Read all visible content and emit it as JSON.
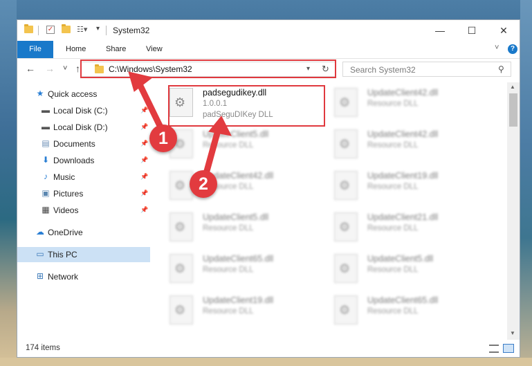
{
  "window": {
    "title": "System32",
    "controls": {
      "minimize": "—",
      "maximize": "☐",
      "close": "✕"
    }
  },
  "ribbon": {
    "tabs": [
      "File",
      "Home",
      "Share",
      "View"
    ],
    "help": "?"
  },
  "navigation": {
    "back": "←",
    "forward": "→",
    "recent": "˅",
    "up": "↑"
  },
  "address": {
    "path": "C:\\Windows\\System32",
    "refresh": "↻"
  },
  "search": {
    "placeholder": "Search System32"
  },
  "nav_pane": {
    "items": [
      {
        "label": "Quick access",
        "icon": "star-icon",
        "pinned": false
      },
      {
        "label": "Local Disk (C:)",
        "icon": "drive-icon",
        "pinned": true
      },
      {
        "label": "Local Disk (D:)",
        "icon": "drive-icon",
        "pinned": true
      },
      {
        "label": "Documents",
        "icon": "documents-icon",
        "pinned": true
      },
      {
        "label": "Downloads",
        "icon": "download-icon",
        "pinned": true
      },
      {
        "label": "Music",
        "icon": "music-icon",
        "pinned": true
      },
      {
        "label": "Pictures",
        "icon": "pictures-icon",
        "pinned": true
      },
      {
        "label": "Videos",
        "icon": "videos-icon",
        "pinned": true
      },
      {
        "label": "OneDrive",
        "icon": "cloud-icon",
        "pinned": false
      },
      {
        "label": "This PC",
        "icon": "computer-icon",
        "pinned": false,
        "selected": true
      },
      {
        "label": "Network",
        "icon": "network-icon",
        "pinned": false
      }
    ]
  },
  "files": [
    {
      "name": "padsegudikey.dll",
      "line2": "1.0.0.1",
      "line3": "padSeguDIKey DLL",
      "highlighted": true
    },
    {
      "name": "UpdateClient42.dll",
      "line2": "Resource DLL"
    },
    {
      "name": "UpdateClient5.dll",
      "line2": "Resource DLL"
    },
    {
      "name": "UpdateClient42.dll",
      "line2": "Resource DLL"
    },
    {
      "name": "UpdateClient42.dll",
      "line2": "Resource DLL"
    },
    {
      "name": "UpdateClient19.dll",
      "line2": "Resource DLL"
    },
    {
      "name": "UpdateClient5.dll",
      "line2": "Resource DLL"
    },
    {
      "name": "UpdateClient21.dll",
      "line2": "Resource DLL"
    },
    {
      "name": "UpdateClient65.dll",
      "line2": "Resource DLL"
    },
    {
      "name": "UpdateClient5.dll",
      "line2": "Resource DLL"
    },
    {
      "name": "UpdateClient19.dll",
      "line2": "Resource DLL"
    },
    {
      "name": "UpdateClient65.dll",
      "line2": "Resource DLL"
    }
  ],
  "status": {
    "item_count": "174 items"
  },
  "annotations": {
    "step1": "1",
    "step2": "2",
    "color": "#e0393e"
  }
}
